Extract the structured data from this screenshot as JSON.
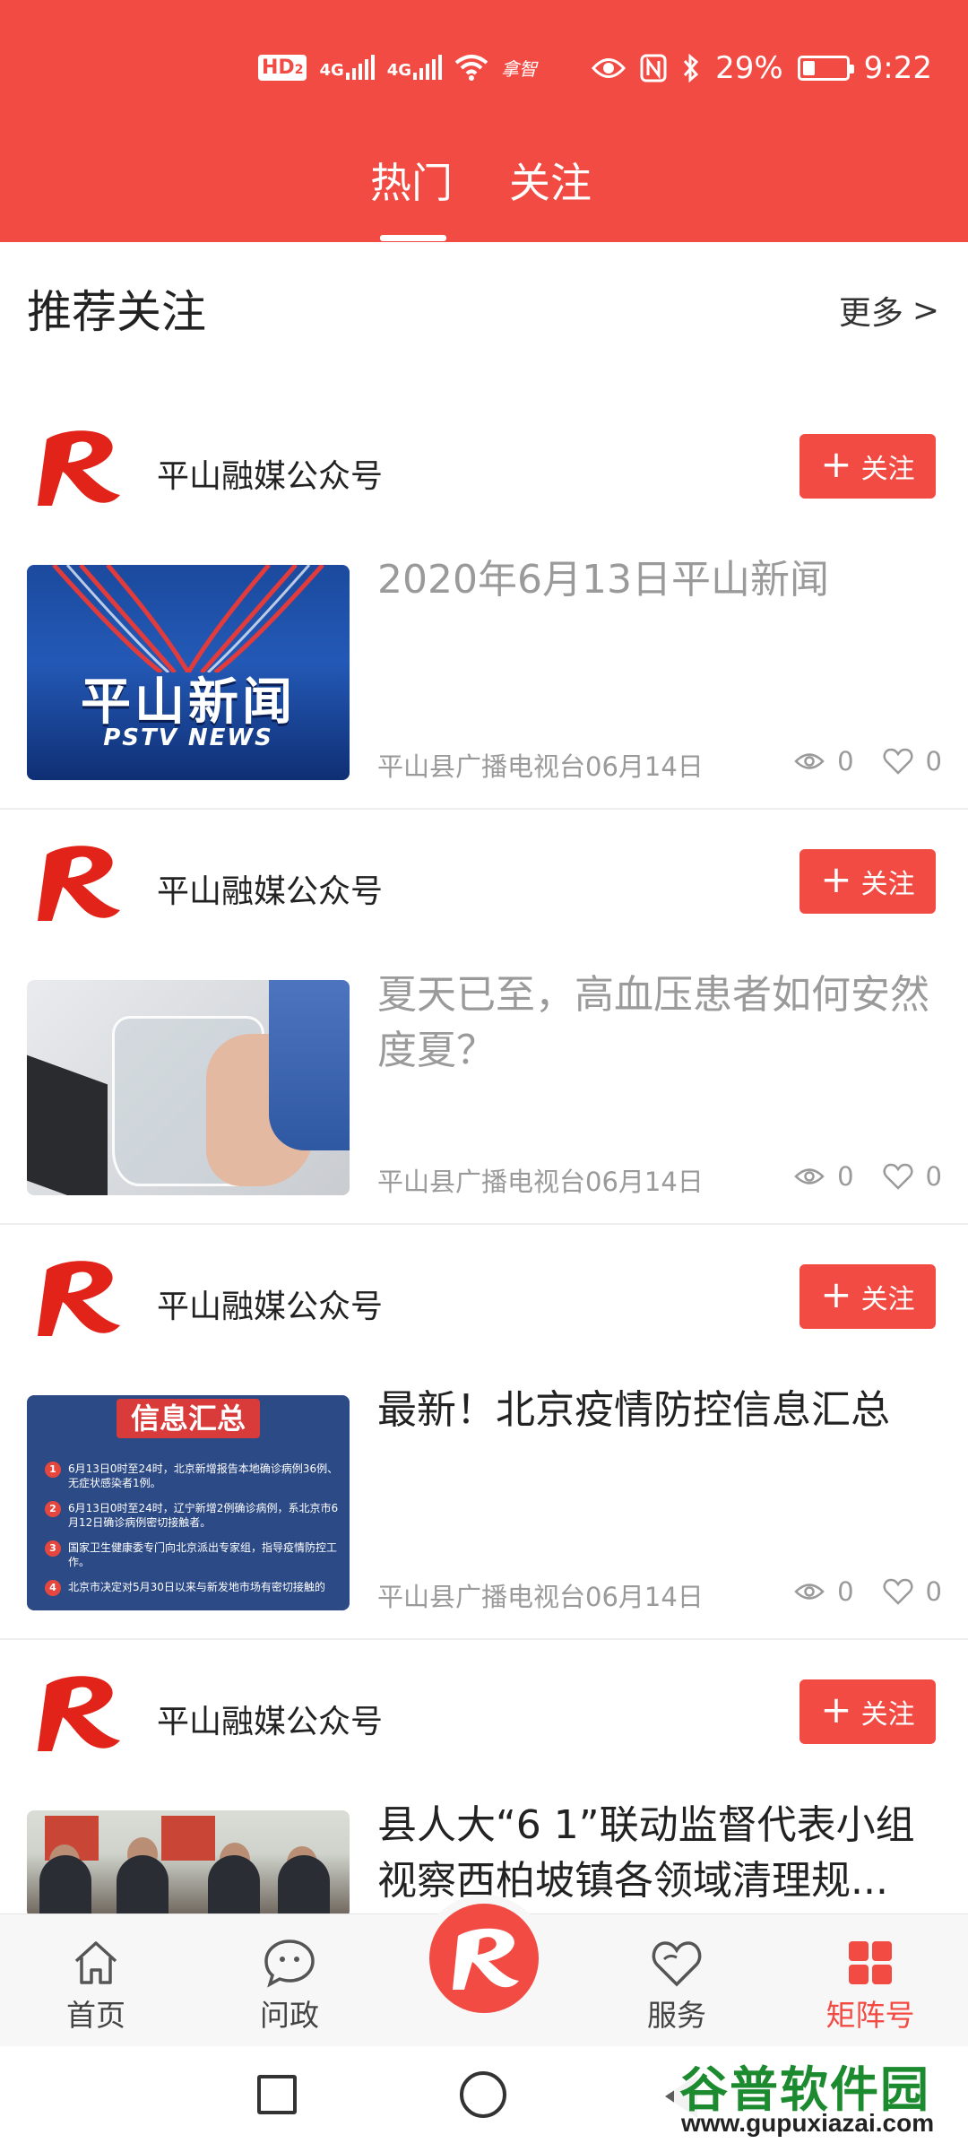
{
  "status_bar": {
    "hd": "HD",
    "hd_sub": "2",
    "net1": "4G",
    "net2": "4G",
    "carrier_note": "拿智",
    "battery_percent_label": "29%",
    "battery_level": 0.29,
    "time": "9:22"
  },
  "top_tabs": [
    {
      "label": "热门",
      "active": true
    },
    {
      "label": "关注",
      "active": false
    }
  ],
  "recommend": {
    "title": "推荐关注",
    "more_label": "更多",
    "more_arrow": ">"
  },
  "cards": [
    {
      "account": "平山融媒公众号",
      "follow_label": "关注",
      "title": "2020年6月13日平山新闻",
      "read": true,
      "source_date": "平山县广播电视台06月14日",
      "views": "0",
      "likes": "0",
      "thumb": {
        "kind": "news",
        "zh": "平山新闻",
        "en": "PSTV NEWS"
      }
    },
    {
      "account": "平山融媒公众号",
      "follow_label": "关注",
      "title": "夏天已至，高血压患者如何安然度夏？",
      "read": true,
      "source_date": "平山县广播电视台06月14日",
      "views": "0",
      "likes": "0",
      "thumb": {
        "kind": "water"
      }
    },
    {
      "account": "平山融媒公众号",
      "follow_label": "关注",
      "title": "最新！北京疫情防控信息汇总",
      "read": false,
      "source_date": "平山县广播电视台06月14日",
      "views": "0",
      "likes": "0",
      "thumb": {
        "kind": "info",
        "banner": "信息汇总",
        "items": [
          {
            "n": "1",
            "text": "6月13日0时至24时，北京新增报告本地确诊病例36例、无症状感染者1例。"
          },
          {
            "n": "2",
            "text": "6月13日0时至24时，辽宁新增2例确诊病例，系北京市6月12日确诊病例密切接触者。"
          },
          {
            "n": "3",
            "text": "国家卫生健康委专门向北京派出专家组，指导疫情防控工作。"
          },
          {
            "n": "4",
            "text": "北京市决定对5月30日以来与新发地市场有密切接触的"
          }
        ]
      }
    },
    {
      "account": "平山融媒公众号",
      "follow_label": "关注",
      "title": "县人大“6 1”联动监督代表小组视察西柏坡镇各领域清理规...",
      "read": false,
      "source_date": "",
      "views": "",
      "likes": "",
      "thumb": {
        "kind": "meeting"
      }
    }
  ],
  "bottom_nav": [
    {
      "label": "首页",
      "icon": "home-icon",
      "active": false
    },
    {
      "label": "问政",
      "icon": "chat-icon",
      "active": false
    },
    {
      "label": "",
      "icon": "app-logo-icon",
      "active": false
    },
    {
      "label": "服务",
      "icon": "heart-icon",
      "active": false
    },
    {
      "label": "矩阵号",
      "icon": "grid-icon",
      "active": true
    }
  ],
  "watermark": {
    "top": "谷普软件园",
    "bottom": "www.gupuxiazai.com"
  },
  "colors": {
    "brand_red": "#f24b43",
    "read_title": "#9a9a9a",
    "meta": "#9a9a9a"
  }
}
